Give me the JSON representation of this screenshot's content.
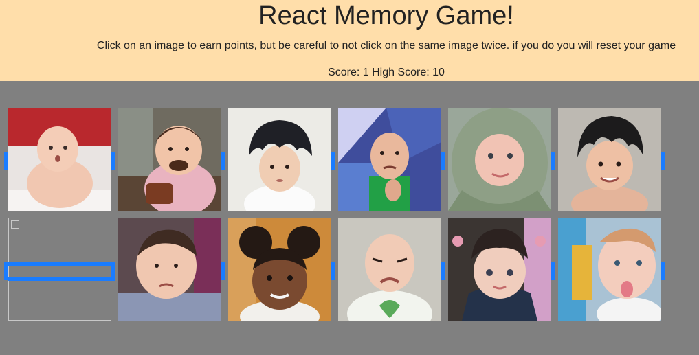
{
  "header": {
    "title": "React Memory Game!",
    "instructions": "Click on an image to earn points, but be careful to not click on the same image twice. if you do you will reset your game",
    "score_text": "Score: 1 High Score: 10"
  },
  "colors": {
    "header_bg": "#ffdeaa",
    "page_bg": "#808080",
    "accent": "#1a7cff"
  },
  "cards": [
    {
      "name": "baby-in-bath-image"
    },
    {
      "name": "baby-chocolate-face-image"
    },
    {
      "name": "baby-spiky-hair-image"
    },
    {
      "name": "success-kid-image"
    },
    {
      "name": "baby-green-headscarf-image"
    },
    {
      "name": "baby-black-spiky-hair-image"
    },
    {
      "name": "broken-image"
    },
    {
      "name": "baby-grumpy-face-image"
    },
    {
      "name": "baby-curly-pigtails-image"
    },
    {
      "name": "baby-crying-image"
    },
    {
      "name": "baby-pigtails-bows-image"
    },
    {
      "name": "baby-tongue-out-image"
    }
  ]
}
